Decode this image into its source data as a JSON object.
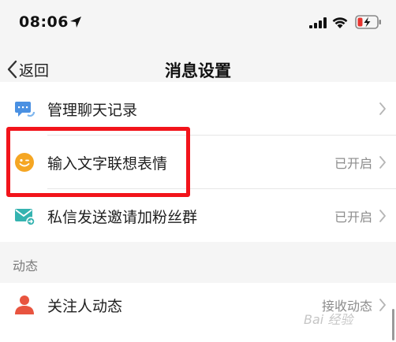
{
  "status_bar": {
    "time": "08:06"
  },
  "nav": {
    "back_label": "返回",
    "title": "消息设置"
  },
  "settings": [
    {
      "label": "管理聊天记录",
      "value": "",
      "icon": "chat-records-icon"
    },
    {
      "label": "输入文字联想表情",
      "value": "已开启",
      "icon": "smiley-face-icon"
    },
    {
      "label": "私信发送邀请加粉丝群",
      "value": "已开启",
      "icon": "mail-send-icon"
    }
  ],
  "section": {
    "label": "动态"
  },
  "dynamics": [
    {
      "label": "关注人动态",
      "value": "接收动态",
      "icon": "person-icon"
    }
  ],
  "watermark": "Bai 经验",
  "colors": {
    "highlight_border": "#f2141b",
    "icon_blue": "#4a90e2",
    "icon_orange": "#f5a623",
    "icon_teal": "#35b3b0",
    "icon_red": "#e8543f"
  }
}
